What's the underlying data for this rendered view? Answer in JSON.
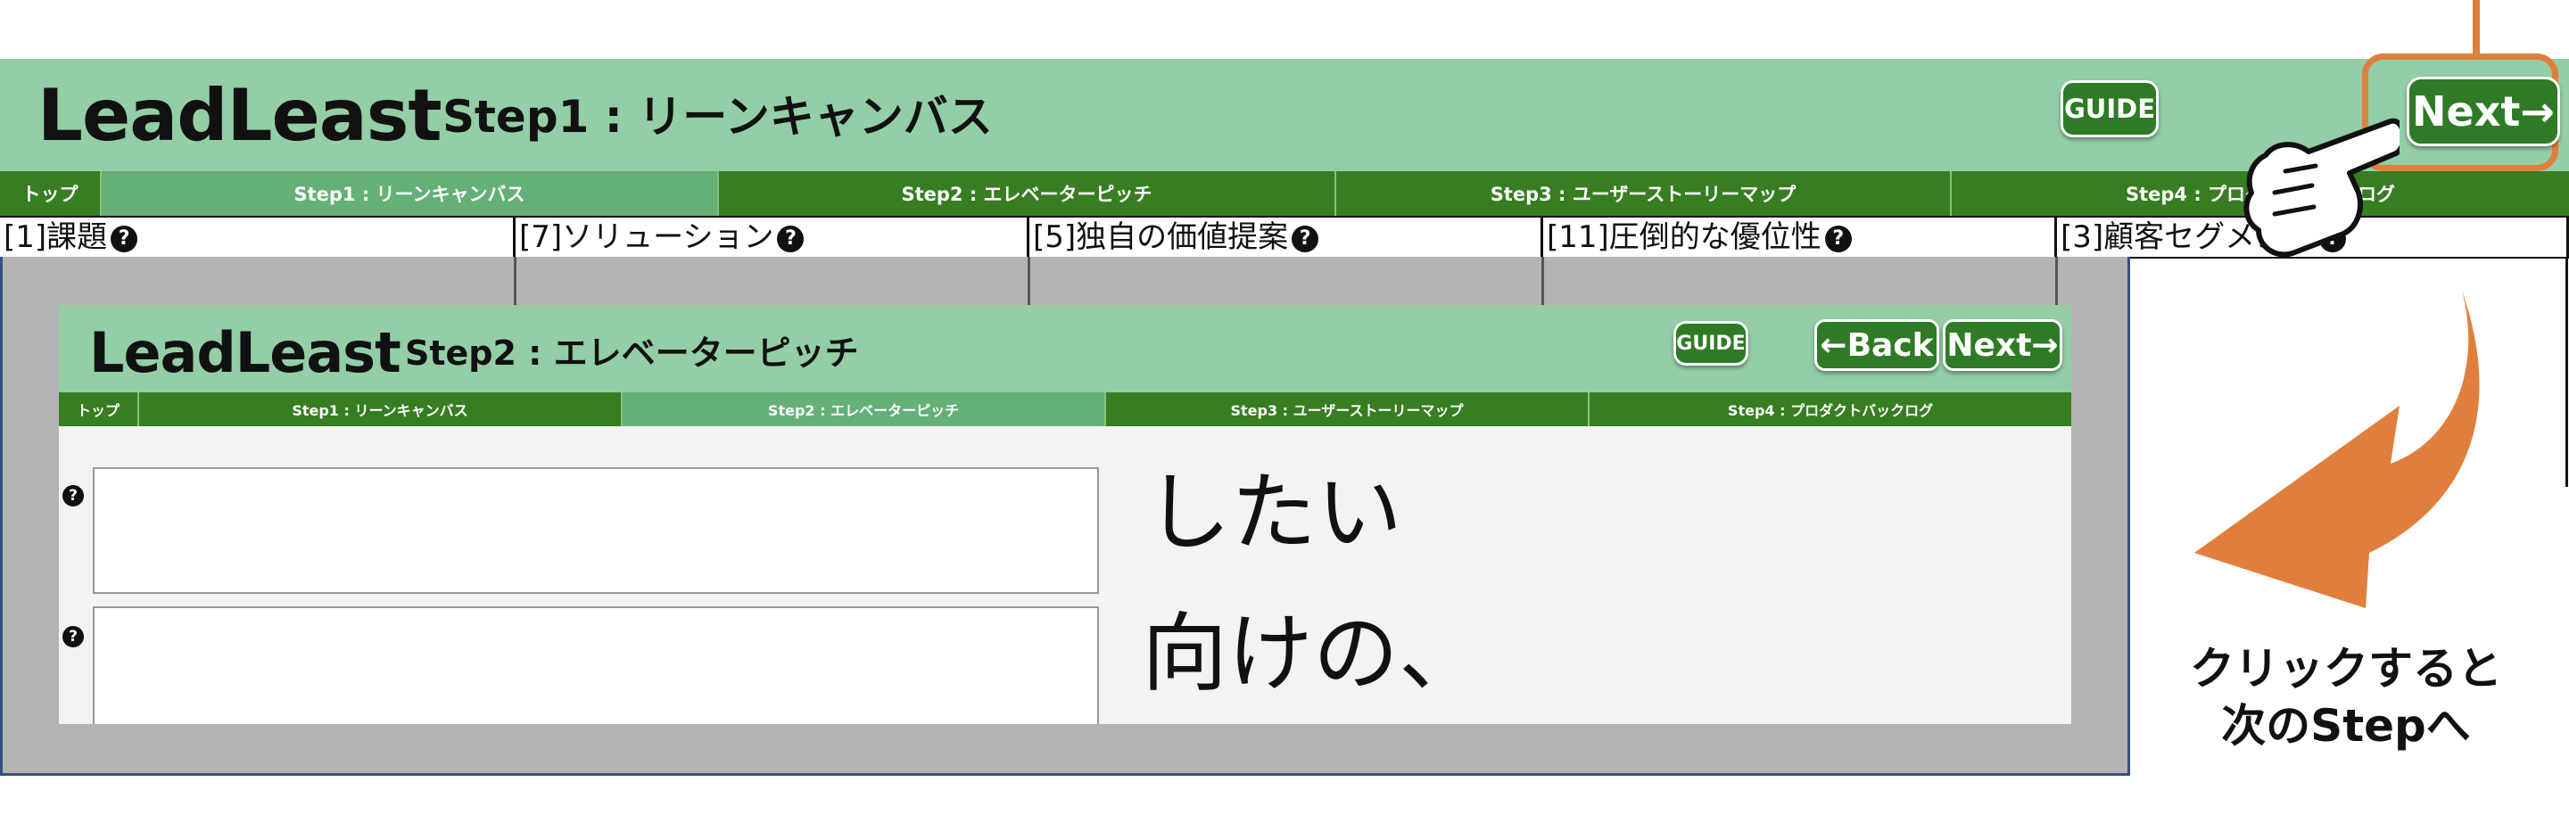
{
  "app": {
    "logo": "LeadLeast",
    "step_title": "Step1 : リーンキャンバス",
    "guide_label": "GUIDE",
    "next_label": "Next→",
    "tabs": [
      {
        "label": "トップ",
        "active": false
      },
      {
        "label": "Step1 : リーンキャンバス",
        "active": true
      },
      {
        "label": "Step2 : エレベーターピッチ",
        "active": false
      },
      {
        "label": "Step3 : ユーザーストーリーマップ",
        "active": false
      },
      {
        "label": "Step4 : プロダクトバックログ",
        "active": false
      }
    ],
    "canvas_cells": [
      {
        "label": "[1]課題"
      },
      {
        "label": "[7]ソリューション"
      },
      {
        "label": "[5]独自の価値提案"
      },
      {
        "label": "[11]圧倒的な優位性"
      },
      {
        "label": "[3]顧客セグメント"
      }
    ],
    "help_icon": "?"
  },
  "inner_app": {
    "logo": "LeadLeast",
    "step_title": "Step2 : エレベーターピッチ",
    "guide_label": "GUIDE",
    "back_label": "←Back",
    "next_label": "Next→",
    "tabs": [
      {
        "label": "トップ",
        "active": false
      },
      {
        "label": "Step1 : リーンキャンバス",
        "active": false
      },
      {
        "label": "Step2 : エレベーターピッチ",
        "active": true
      },
      {
        "label": "Step3 : ユーザーストーリーマップ",
        "active": false
      },
      {
        "label": "Step4 : プロダクトバックログ",
        "active": false
      }
    ],
    "pitch_rows": [
      {
        "value": "",
        "suffix": "したい"
      },
      {
        "value": "",
        "suffix": "向けの、"
      }
    ]
  },
  "annotation": {
    "line1": "クリックすると",
    "line2": "次のStepへ"
  },
  "colors": {
    "header_green": "#93cea6",
    "nav_green": "#377d22",
    "active_tab": "#64b077",
    "button_green": "#2f7a26",
    "highlight_orange": "#e07f3c",
    "overlay_gray": "#b4b4b4"
  },
  "icons": [
    "pointing-hand-icon",
    "curved-arrow-icon",
    "help-circle-icon"
  ]
}
